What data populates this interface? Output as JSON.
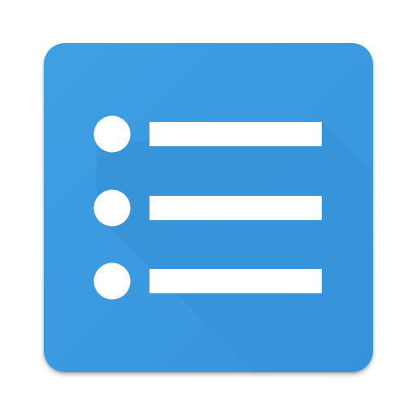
{
  "icon": {
    "name": "bulleted-list-icon",
    "background_color": "#3A9AE0",
    "shadow_color": "#1F6FB0",
    "glyph_color": "#FFFFFF",
    "bullet_rows": 3
  }
}
